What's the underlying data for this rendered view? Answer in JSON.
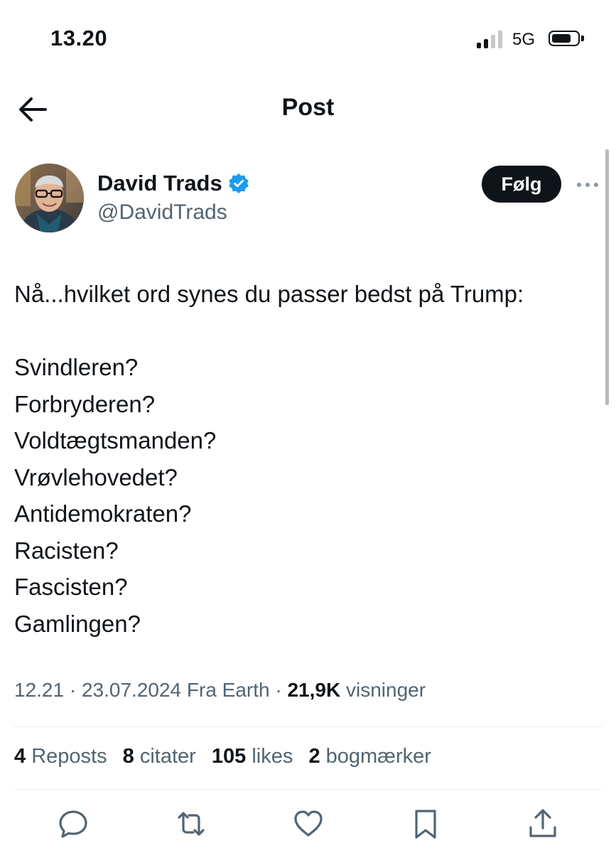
{
  "status_bar": {
    "time": "13.20",
    "network": "5G"
  },
  "header": {
    "title": "Post"
  },
  "author": {
    "name": "David Trads",
    "handle": "@DavidTrads",
    "verified": true,
    "follow_label": "Følg"
  },
  "post": {
    "text": "Nå...hvilket ord synes du passer bedst på Trump:\n\nSvindleren?\nForbryderen?\nVoldtægtsmanden?\nVrøvlehovedet?\nAntidemokraten?\nRacisten?\nFascisten?\nGamlingen?"
  },
  "meta": {
    "time": "12.21",
    "date": "23.07.2024",
    "source": "Fra Earth",
    "views_count": "21,9K",
    "views_label": "visninger",
    "separator": "·"
  },
  "stats": {
    "reposts_count": "4",
    "reposts_label": "Reposts",
    "quotes_count": "8",
    "quotes_label": "citater",
    "likes_count": "105",
    "likes_label": "likes",
    "bookmarks_count": "2",
    "bookmarks_label": "bogmærker"
  },
  "actions": [
    "reply-icon",
    "repost-icon",
    "like-icon",
    "bookmark-icon",
    "share-icon"
  ],
  "colors": {
    "text_primary": "#0f1419",
    "text_secondary": "#536471",
    "verified_blue": "#1d9bf0",
    "follow_bg": "#0f1419",
    "divider": "#e6ecf0"
  }
}
